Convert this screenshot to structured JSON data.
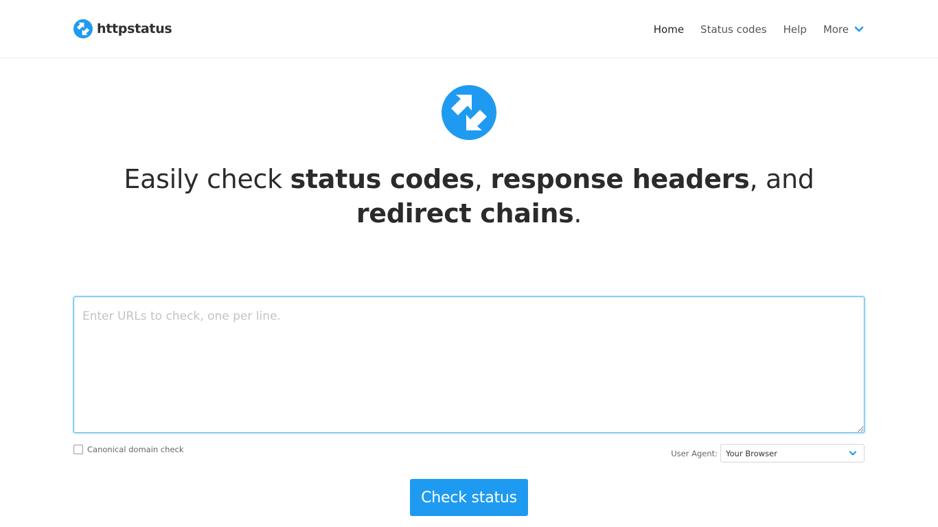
{
  "brand": {
    "name": "httpstatus",
    "logo_icon": "httpstatus-logo-icon",
    "accent_color": "#1e9bf0"
  },
  "nav": {
    "items": [
      {
        "label": "Home",
        "active": true
      },
      {
        "label": "Status codes",
        "active": false
      },
      {
        "label": "Help",
        "active": false
      },
      {
        "label": "More",
        "active": false,
        "icon": "chevron-down-icon"
      }
    ]
  },
  "hero": {
    "headline": {
      "p1": "Easily check ",
      "b1": "status codes",
      "p2": ", ",
      "b2": "response headers",
      "p3": ", and ",
      "b3": "redirect chains",
      "p4": "."
    }
  },
  "form": {
    "urls_placeholder": "Enter URLs to check, one per line.",
    "urls_value": "",
    "canonical_label": "Canonical domain check",
    "canonical_checked": false,
    "user_agent_label": "User Agent:",
    "user_agent_value": "Your Browser",
    "submit_label": "Check status"
  }
}
